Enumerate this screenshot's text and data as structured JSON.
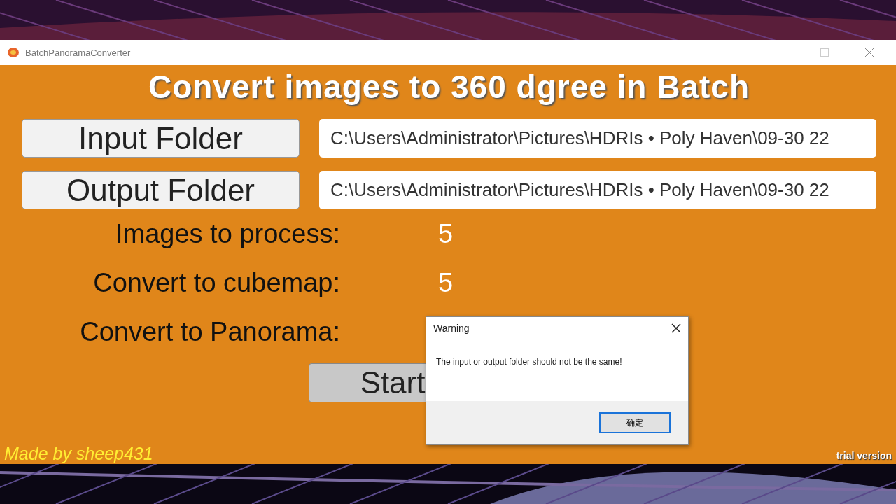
{
  "window": {
    "title": "BatchPanoramaConverter"
  },
  "heading": "Convert images to 360 dgree in Batch",
  "folders": [
    {
      "button": "Input Folder",
      "path": "C:\\Users\\Administrator\\Pictures\\HDRIs • Poly Haven\\09-30 22"
    },
    {
      "button": "Output Folder",
      "path": "C:\\Users\\Administrator\\Pictures\\HDRIs • Poly Haven\\09-30 22"
    }
  ],
  "stats": [
    {
      "label": "Images to process:",
      "value": "5"
    },
    {
      "label": "Convert to cubemap:",
      "value": "5"
    },
    {
      "label": "Convert to Panorama:"
    }
  ],
  "start_button": "Start",
  "credit": "Made by sheep431",
  "edition": "trial version",
  "dialog": {
    "title": "Warning",
    "message": "The input or output folder should not be the same!",
    "button": "确定"
  }
}
